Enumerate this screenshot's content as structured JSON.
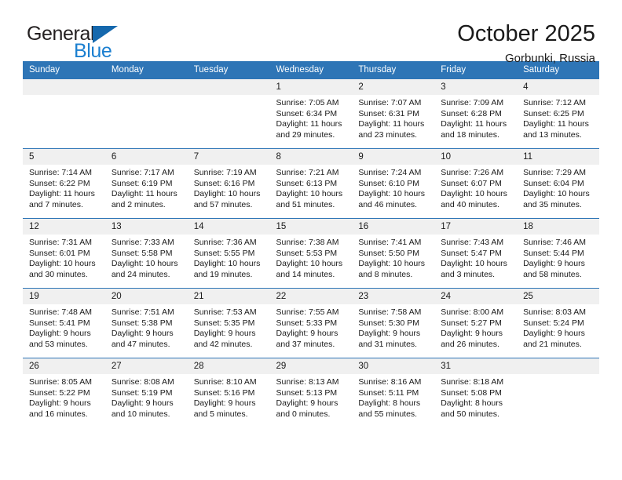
{
  "brand": {
    "word1": "General",
    "word2": "Blue",
    "triangle_color": "#1568ad",
    "blue_color": "#1b7fd0"
  },
  "header": {
    "title": "October 2025",
    "subtitle": "Gorbunki, Russia"
  },
  "theme": {
    "header_blue": "#2e75b6",
    "daynum_band": "#f0f0f0",
    "text": "#1a1a1a"
  },
  "weekday_headers": [
    "Sunday",
    "Monday",
    "Tuesday",
    "Wednesday",
    "Thursday",
    "Friday",
    "Saturday"
  ],
  "weeks": [
    [
      {
        "day": "",
        "lines": []
      },
      {
        "day": "",
        "lines": []
      },
      {
        "day": "",
        "lines": []
      },
      {
        "day": "1",
        "lines": [
          "Sunrise: 7:05 AM",
          "Sunset: 6:34 PM",
          "Daylight: 11 hours",
          "and 29 minutes."
        ]
      },
      {
        "day": "2",
        "lines": [
          "Sunrise: 7:07 AM",
          "Sunset: 6:31 PM",
          "Daylight: 11 hours",
          "and 23 minutes."
        ]
      },
      {
        "day": "3",
        "lines": [
          "Sunrise: 7:09 AM",
          "Sunset: 6:28 PM",
          "Daylight: 11 hours",
          "and 18 minutes."
        ]
      },
      {
        "day": "4",
        "lines": [
          "Sunrise: 7:12 AM",
          "Sunset: 6:25 PM",
          "Daylight: 11 hours",
          "and 13 minutes."
        ]
      }
    ],
    [
      {
        "day": "5",
        "lines": [
          "Sunrise: 7:14 AM",
          "Sunset: 6:22 PM",
          "Daylight: 11 hours",
          "and 7 minutes."
        ]
      },
      {
        "day": "6",
        "lines": [
          "Sunrise: 7:17 AM",
          "Sunset: 6:19 PM",
          "Daylight: 11 hours",
          "and 2 minutes."
        ]
      },
      {
        "day": "7",
        "lines": [
          "Sunrise: 7:19 AM",
          "Sunset: 6:16 PM",
          "Daylight: 10 hours",
          "and 57 minutes."
        ]
      },
      {
        "day": "8",
        "lines": [
          "Sunrise: 7:21 AM",
          "Sunset: 6:13 PM",
          "Daylight: 10 hours",
          "and 51 minutes."
        ]
      },
      {
        "day": "9",
        "lines": [
          "Sunrise: 7:24 AM",
          "Sunset: 6:10 PM",
          "Daylight: 10 hours",
          "and 46 minutes."
        ]
      },
      {
        "day": "10",
        "lines": [
          "Sunrise: 7:26 AM",
          "Sunset: 6:07 PM",
          "Daylight: 10 hours",
          "and 40 minutes."
        ]
      },
      {
        "day": "11",
        "lines": [
          "Sunrise: 7:29 AM",
          "Sunset: 6:04 PM",
          "Daylight: 10 hours",
          "and 35 minutes."
        ]
      }
    ],
    [
      {
        "day": "12",
        "lines": [
          "Sunrise: 7:31 AM",
          "Sunset: 6:01 PM",
          "Daylight: 10 hours",
          "and 30 minutes."
        ]
      },
      {
        "day": "13",
        "lines": [
          "Sunrise: 7:33 AM",
          "Sunset: 5:58 PM",
          "Daylight: 10 hours",
          "and 24 minutes."
        ]
      },
      {
        "day": "14",
        "lines": [
          "Sunrise: 7:36 AM",
          "Sunset: 5:55 PM",
          "Daylight: 10 hours",
          "and 19 minutes."
        ]
      },
      {
        "day": "15",
        "lines": [
          "Sunrise: 7:38 AM",
          "Sunset: 5:53 PM",
          "Daylight: 10 hours",
          "and 14 minutes."
        ]
      },
      {
        "day": "16",
        "lines": [
          "Sunrise: 7:41 AM",
          "Sunset: 5:50 PM",
          "Daylight: 10 hours",
          "and 8 minutes."
        ]
      },
      {
        "day": "17",
        "lines": [
          "Sunrise: 7:43 AM",
          "Sunset: 5:47 PM",
          "Daylight: 10 hours",
          "and 3 minutes."
        ]
      },
      {
        "day": "18",
        "lines": [
          "Sunrise: 7:46 AM",
          "Sunset: 5:44 PM",
          "Daylight: 9 hours",
          "and 58 minutes."
        ]
      }
    ],
    [
      {
        "day": "19",
        "lines": [
          "Sunrise: 7:48 AM",
          "Sunset: 5:41 PM",
          "Daylight: 9 hours",
          "and 53 minutes."
        ]
      },
      {
        "day": "20",
        "lines": [
          "Sunrise: 7:51 AM",
          "Sunset: 5:38 PM",
          "Daylight: 9 hours",
          "and 47 minutes."
        ]
      },
      {
        "day": "21",
        "lines": [
          "Sunrise: 7:53 AM",
          "Sunset: 5:35 PM",
          "Daylight: 9 hours",
          "and 42 minutes."
        ]
      },
      {
        "day": "22",
        "lines": [
          "Sunrise: 7:55 AM",
          "Sunset: 5:33 PM",
          "Daylight: 9 hours",
          "and 37 minutes."
        ]
      },
      {
        "day": "23",
        "lines": [
          "Sunrise: 7:58 AM",
          "Sunset: 5:30 PM",
          "Daylight: 9 hours",
          "and 31 minutes."
        ]
      },
      {
        "day": "24",
        "lines": [
          "Sunrise: 8:00 AM",
          "Sunset: 5:27 PM",
          "Daylight: 9 hours",
          "and 26 minutes."
        ]
      },
      {
        "day": "25",
        "lines": [
          "Sunrise: 8:03 AM",
          "Sunset: 5:24 PM",
          "Daylight: 9 hours",
          "and 21 minutes."
        ]
      }
    ],
    [
      {
        "day": "26",
        "lines": [
          "Sunrise: 8:05 AM",
          "Sunset: 5:22 PM",
          "Daylight: 9 hours",
          "and 16 minutes."
        ]
      },
      {
        "day": "27",
        "lines": [
          "Sunrise: 8:08 AM",
          "Sunset: 5:19 PM",
          "Daylight: 9 hours",
          "and 10 minutes."
        ]
      },
      {
        "day": "28",
        "lines": [
          "Sunrise: 8:10 AM",
          "Sunset: 5:16 PM",
          "Daylight: 9 hours",
          "and 5 minutes."
        ]
      },
      {
        "day": "29",
        "lines": [
          "Sunrise: 8:13 AM",
          "Sunset: 5:13 PM",
          "Daylight: 9 hours",
          "and 0 minutes."
        ]
      },
      {
        "day": "30",
        "lines": [
          "Sunrise: 8:16 AM",
          "Sunset: 5:11 PM",
          "Daylight: 8 hours",
          "and 55 minutes."
        ]
      },
      {
        "day": "31",
        "lines": [
          "Sunrise: 8:18 AM",
          "Sunset: 5:08 PM",
          "Daylight: 8 hours",
          "and 50 minutes."
        ]
      },
      {
        "day": "",
        "lines": []
      }
    ]
  ]
}
